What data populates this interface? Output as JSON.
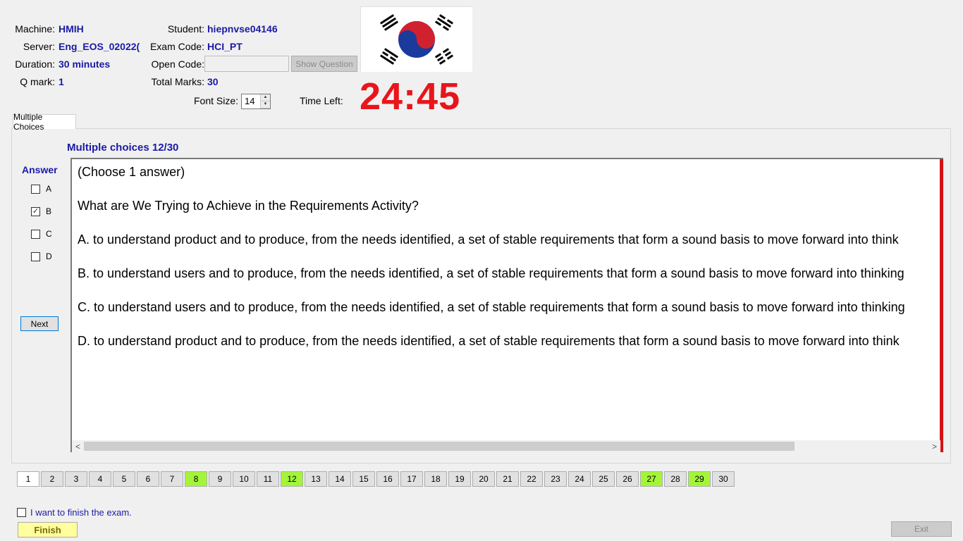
{
  "header": {
    "machine_label": "Machine:",
    "machine_value": "HMIH",
    "server_label": "Server:",
    "server_value": "Eng_EOS_02022(",
    "duration_label": "Duration:",
    "duration_value": "30 minutes",
    "qmark_label": "Q mark:",
    "qmark_value": "1",
    "student_label": "Student:",
    "student_value": "hiepnvse04146",
    "exam_code_label": "Exam Code:",
    "exam_code_value": "HCI_PT",
    "open_code_label": "Open Code:",
    "open_code_value": "",
    "show_question_label": "Show Question",
    "total_marks_label": "Total Marks:",
    "total_marks_value": "30",
    "font_size_label": "Font Size:",
    "font_size_value": "14",
    "time_left_label": "Time Left:",
    "time_left_value": "24:45",
    "flag_icon": "south-korea-flag"
  },
  "tab": {
    "label": "Multiple Choices"
  },
  "main": {
    "section_title": "Multiple choices 12/30",
    "answer_title": "Answer",
    "options": [
      {
        "letter": "A",
        "checked": false
      },
      {
        "letter": "B",
        "checked": true
      },
      {
        "letter": "C",
        "checked": false
      },
      {
        "letter": "D",
        "checked": false
      }
    ],
    "next_label": "Next",
    "question_lines": [
      "(Choose 1 answer)",
      "What are We Trying to Achieve in the Requirements Activity?",
      "A.  to understand product and  to produce, from the needs identified, a set of stable requirements that form a sound basis to move forward into think",
      "B.  to understand users and  to produce, from the needs identified, a set of stable requirements that form a sound basis to move forward into thinking",
      "C.  to understand users and  to produce, from the needs identified, a set of stable requirements that form a sound basis to move forward into thinking",
      "D.  to understand product and  to produce, from the needs identified, a set of stable requirements that form a sound basis to move forward into think"
    ]
  },
  "navigation": {
    "questions": [
      "1",
      "2",
      "3",
      "4",
      "5",
      "6",
      "7",
      "8",
      "9",
      "10",
      "11",
      "12",
      "13",
      "14",
      "15",
      "16",
      "17",
      "18",
      "19",
      "20",
      "21",
      "22",
      "23",
      "24",
      "25",
      "26",
      "27",
      "28",
      "29",
      "30"
    ],
    "answered": [
      "8",
      "12",
      "27",
      "29"
    ],
    "current": "1",
    "answered_color": "#a3f53a"
  },
  "footer": {
    "finish_confirm_label": "I want to finish the exam.",
    "finish_label": "Finish",
    "exit_label": "Exit"
  }
}
